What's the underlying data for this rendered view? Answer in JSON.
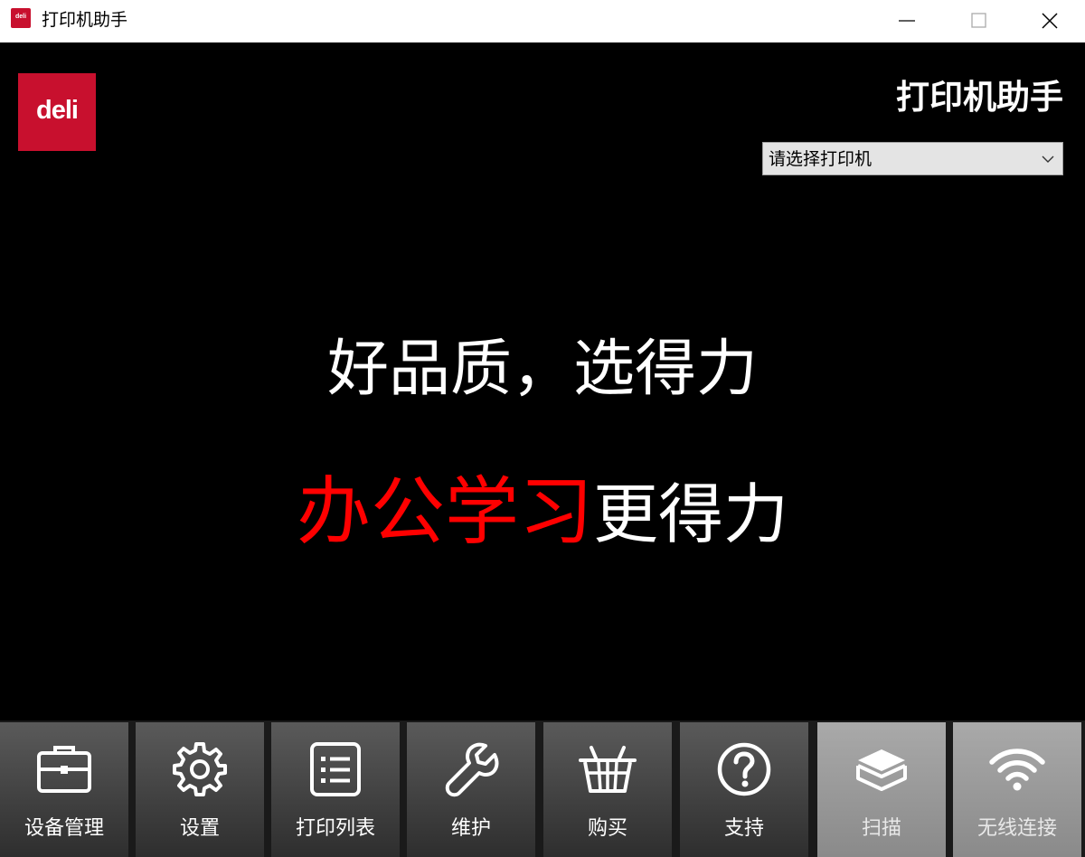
{
  "window": {
    "title": "打印机助手",
    "icon_text": "deli"
  },
  "header": {
    "logo_text": "deli",
    "app_title": "打印机助手",
    "printer_select": {
      "value": "请选择打印机"
    }
  },
  "banner": {
    "line1": "好品质，选得力",
    "line2_highlight": "办公学习",
    "line2_rest": "更得力"
  },
  "toolbar": {
    "items": [
      {
        "label": "设备管理",
        "icon": "briefcase-icon",
        "enabled": true
      },
      {
        "label": "设置",
        "icon": "gear-icon",
        "enabled": true
      },
      {
        "label": "打印列表",
        "icon": "list-icon",
        "enabled": true
      },
      {
        "label": "维护",
        "icon": "wrench-icon",
        "enabled": true
      },
      {
        "label": "购买",
        "icon": "basket-icon",
        "enabled": true
      },
      {
        "label": "支持",
        "icon": "question-icon",
        "enabled": true
      },
      {
        "label": "扫描",
        "icon": "scanner-icon",
        "enabled": false
      },
      {
        "label": "无线连接",
        "icon": "wifi-icon",
        "enabled": false
      }
    ]
  },
  "colors": {
    "brand": "#c8102e",
    "highlight": "#ff0000",
    "background": "#000000"
  }
}
